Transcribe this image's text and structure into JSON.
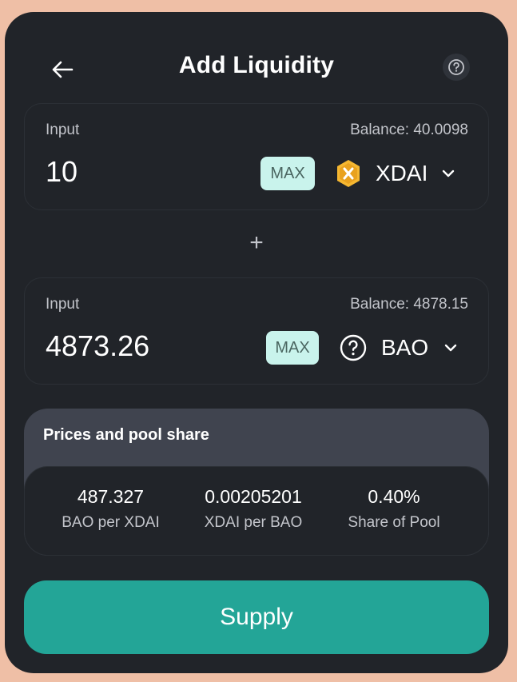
{
  "header": {
    "title": "Add Liquidity",
    "back_icon": "arrow-left-icon",
    "help_icon": "question-circle-icon"
  },
  "input_a": {
    "label": "Input",
    "balance": "Balance: 40.0098",
    "amount": "10",
    "max_label": "MAX",
    "token": "XDAI",
    "token_icon": "xdai-logo-icon"
  },
  "plus_symbol": "+",
  "input_b": {
    "label": "Input",
    "balance": "Balance: 4878.15",
    "amount": "4873.26",
    "max_label": "MAX",
    "token": "BAO",
    "token_icon": "question-circle-icon"
  },
  "prices": {
    "title": "Prices and pool share",
    "stats": [
      {
        "value": "487.327",
        "label": "BAO per XDAI"
      },
      {
        "value": "0.00205201",
        "label": "XDAI per BAO"
      },
      {
        "value": "0.40%",
        "label": "Share of Pool"
      }
    ]
  },
  "supply_label": "Supply",
  "colors": {
    "background": "#efbfa6",
    "card": "#212429",
    "accent": "#23a597",
    "max_bg": "#c9f3ec",
    "xdai_yellow": "#f5b731"
  }
}
